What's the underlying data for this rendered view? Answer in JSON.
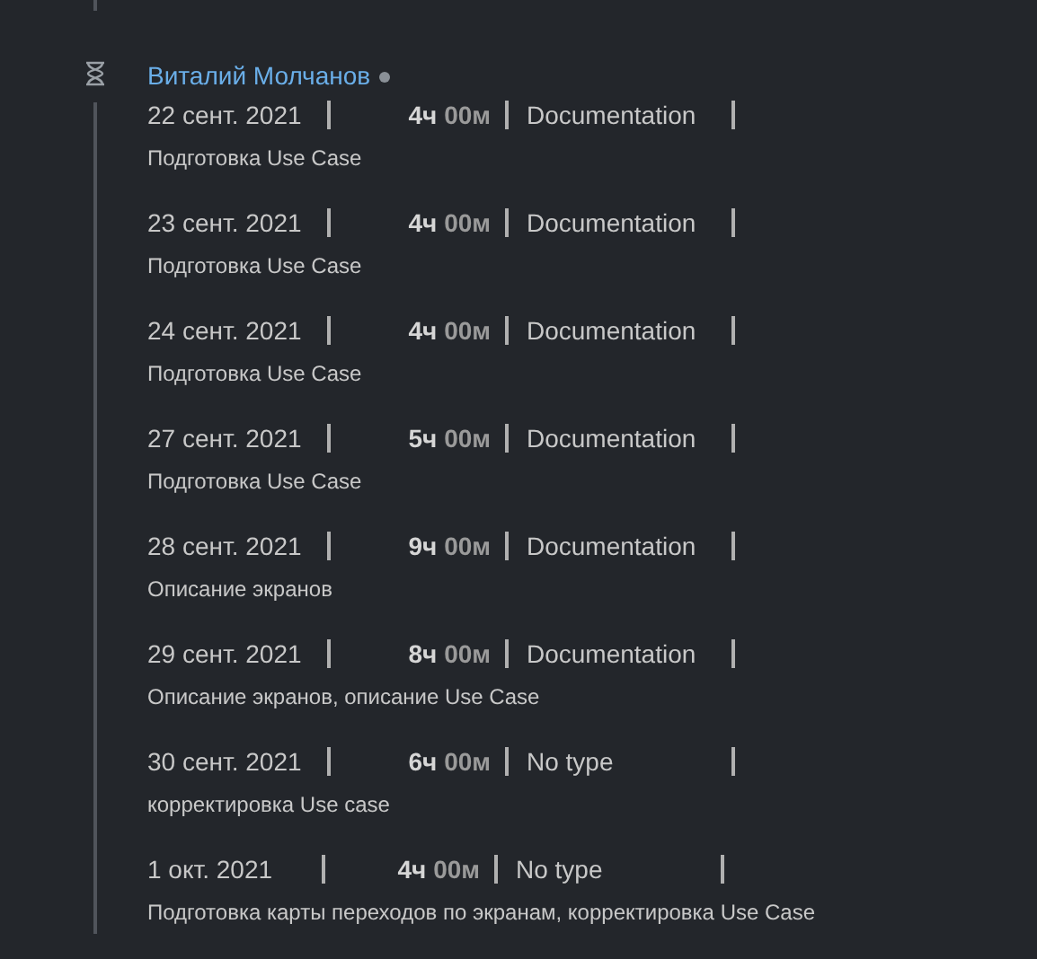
{
  "user": {
    "name": "Виталий Молчанов",
    "online": false
  },
  "entries": [
    {
      "date": "22 сент. 2021",
      "hours": "4ч",
      "minutes": "00м",
      "type": "Documentation",
      "description": "Подготовка Use Case"
    },
    {
      "date": "23 сент. 2021",
      "hours": "4ч",
      "minutes": "00м",
      "type": "Documentation",
      "description": "Подготовка Use Case"
    },
    {
      "date": "24 сент. 2021",
      "hours": "4ч",
      "minutes": "00м",
      "type": "Documentation",
      "description": "Подготовка Use Case"
    },
    {
      "date": "27 сент. 2021",
      "hours": "5ч",
      "minutes": "00м",
      "type": "Documentation",
      "description": "Подготовка Use Case"
    },
    {
      "date": "28 сент. 2021",
      "hours": "9ч",
      "minutes": "00м",
      "type": "Documentation",
      "description": "Описание экранов"
    },
    {
      "date": "29 сент. 2021",
      "hours": "8ч",
      "minutes": "00м",
      "type": "Documentation",
      "description": "Описание экранов, описание Use Case"
    },
    {
      "date": "30 сент. 2021",
      "hours": "6ч",
      "minutes": "00м",
      "type": "No type",
      "description": "корректировка Use case"
    },
    {
      "date": "1 окт. 2021",
      "hours": "4ч",
      "minutes": "00м",
      "type": "No type",
      "description": "Подготовка карты переходов по экранам, корректировка Use Case"
    }
  ]
}
